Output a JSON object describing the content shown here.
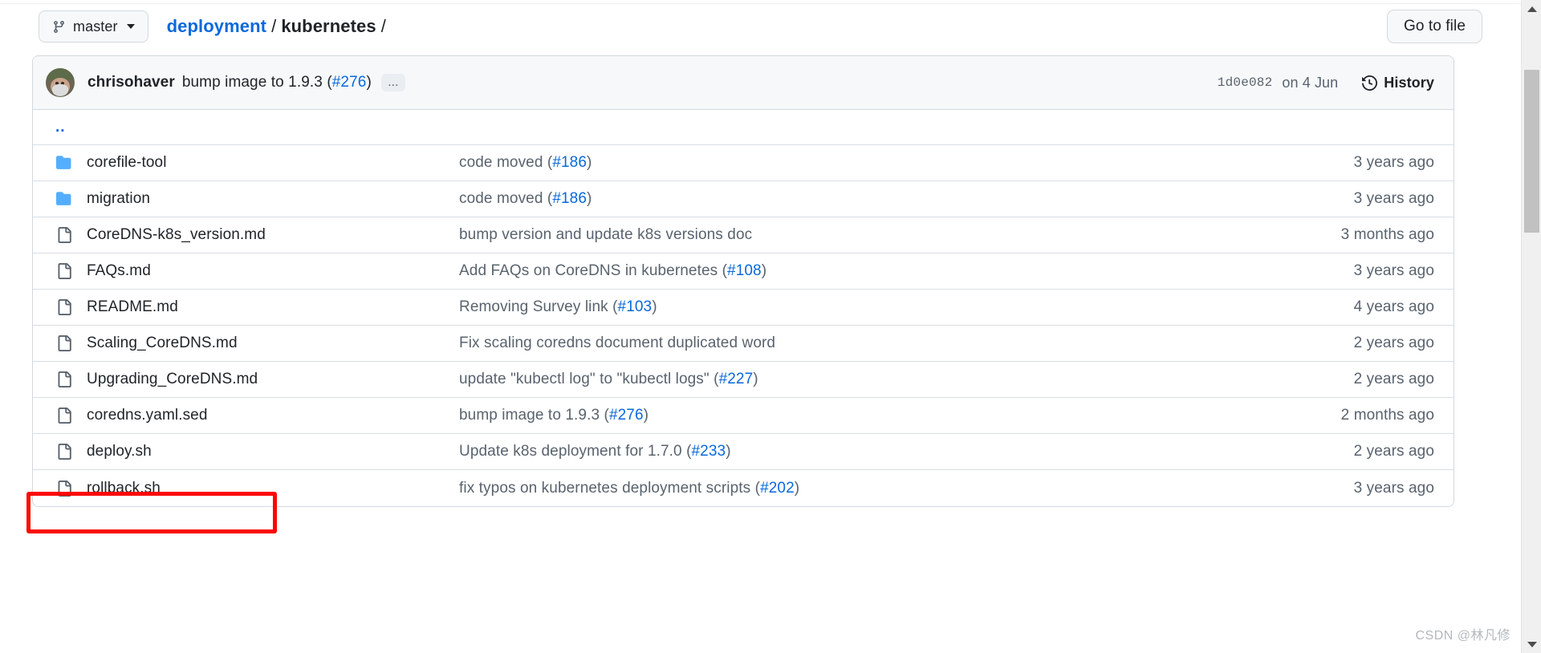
{
  "header": {
    "branch": {
      "label": "master",
      "icon": "git-branch-icon",
      "caret": "chevron-down-icon"
    },
    "breadcrumb": {
      "repo_link": "deployment",
      "sep1": "/",
      "current": "kubernetes",
      "sep2": "/"
    },
    "goto_file_label": "Go to file"
  },
  "latest_commit": {
    "author": "chrisohaver",
    "message_pre": "bump image to 1.9.3 (",
    "message_link": "#276",
    "message_post": ")",
    "expand_label": "...",
    "hash": "1d0e082",
    "date": "on 4 Jun",
    "history_label": "History",
    "history_icon": "clock-history-icon"
  },
  "table": {
    "parent_dir": "..",
    "rows": [
      {
        "name": "corefile-tool",
        "type": "directory",
        "icon": "folder-icon",
        "msg_pre": "code moved (",
        "msg_link": "#186",
        "msg_post": ")",
        "time": "3 years ago",
        "highlighted": false
      },
      {
        "name": "migration",
        "type": "directory",
        "icon": "folder-icon",
        "msg_pre": "code moved (",
        "msg_link": "#186",
        "msg_post": ")",
        "time": "3 years ago",
        "highlighted": false
      },
      {
        "name": "CoreDNS-k8s_version.md",
        "type": "file",
        "icon": "file-icon",
        "msg_pre": "bump version and update k8s versions doc",
        "msg_link": "",
        "msg_post": "",
        "time": "3 months ago",
        "highlighted": false
      },
      {
        "name": "FAQs.md",
        "type": "file",
        "icon": "file-icon",
        "msg_pre": "Add FAQs on CoreDNS in kubernetes (",
        "msg_link": "#108",
        "msg_post": ")",
        "time": "3 years ago",
        "highlighted": false
      },
      {
        "name": "README.md",
        "type": "file",
        "icon": "file-icon",
        "msg_pre": "Removing Survey link (",
        "msg_link": "#103",
        "msg_post": ")",
        "time": "4 years ago",
        "highlighted": false
      },
      {
        "name": "Scaling_CoreDNS.md",
        "type": "file",
        "icon": "file-icon",
        "msg_pre": "Fix scaling coredns document duplicated word",
        "msg_link": "",
        "msg_post": "",
        "time": "2 years ago",
        "highlighted": false
      },
      {
        "name": "Upgrading_CoreDNS.md",
        "type": "file",
        "icon": "file-icon",
        "msg_pre": "update \"kubectl log\" to \"kubectl logs\" (",
        "msg_link": "#227",
        "msg_post": ")",
        "time": "2 years ago",
        "highlighted": false
      },
      {
        "name": "coredns.yaml.sed",
        "type": "file",
        "icon": "file-icon",
        "msg_pre": "bump image to 1.9.3 (",
        "msg_link": "#276",
        "msg_post": ")",
        "time": "2 months ago",
        "highlighted": true
      },
      {
        "name": "deploy.sh",
        "type": "file",
        "icon": "file-icon",
        "msg_pre": "Update k8s deployment for 1.7.0 (",
        "msg_link": "#233",
        "msg_post": ")",
        "time": "2 years ago",
        "highlighted": false
      },
      {
        "name": "rollback.sh",
        "type": "file",
        "icon": "file-icon",
        "msg_pre": "fix typos on kubernetes deployment scripts (",
        "msg_link": "#202",
        "msg_post": ")",
        "time": "3 years ago",
        "highlighted": false
      }
    ]
  },
  "annotation": {
    "color": "#fb0704",
    "target": "coredns.yaml.sed"
  },
  "watermark": "CSDN @林凡修",
  "colors": {
    "link": "#0969da",
    "text": "#1f2328",
    "muted": "#59636e",
    "border": "#d1d9e0",
    "header_bg": "#f6f8fa",
    "folder": "#54aeff",
    "annotation": "#fb0704"
  }
}
